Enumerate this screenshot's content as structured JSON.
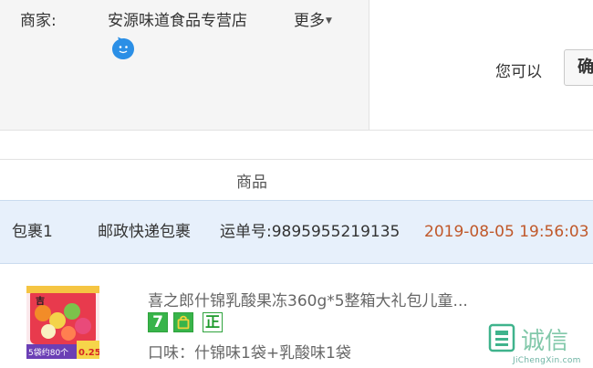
{
  "seller": {
    "label": "商家:",
    "name": "安源味道食品专营店",
    "more_label": "更多",
    "chat_icon": "chat-bubble-icon"
  },
  "actions": {
    "prompt_text": "您可以",
    "confirm_label": "确"
  },
  "table": {
    "column_header": "商品"
  },
  "package": {
    "name": "包裹1",
    "carrier": "邮政快递包裹",
    "tracking": "运单号:9895955219135",
    "time": "2019-08-05 19:56:03",
    "time_color": "#c0582a"
  },
  "product": {
    "title": "喜之郎什锦乳酸果冻360g*5整箱大礼包儿童...",
    "thumb_text": "5袋约80个",
    "thumb_price": "0.25",
    "badges": {
      "seven_day": "7",
      "genuine": "正"
    },
    "flavor": "口味：什锦味1袋+乳酸味1袋"
  },
  "watermark": {
    "logo_text": "诚信",
    "url": "JiChengXin.com"
  }
}
